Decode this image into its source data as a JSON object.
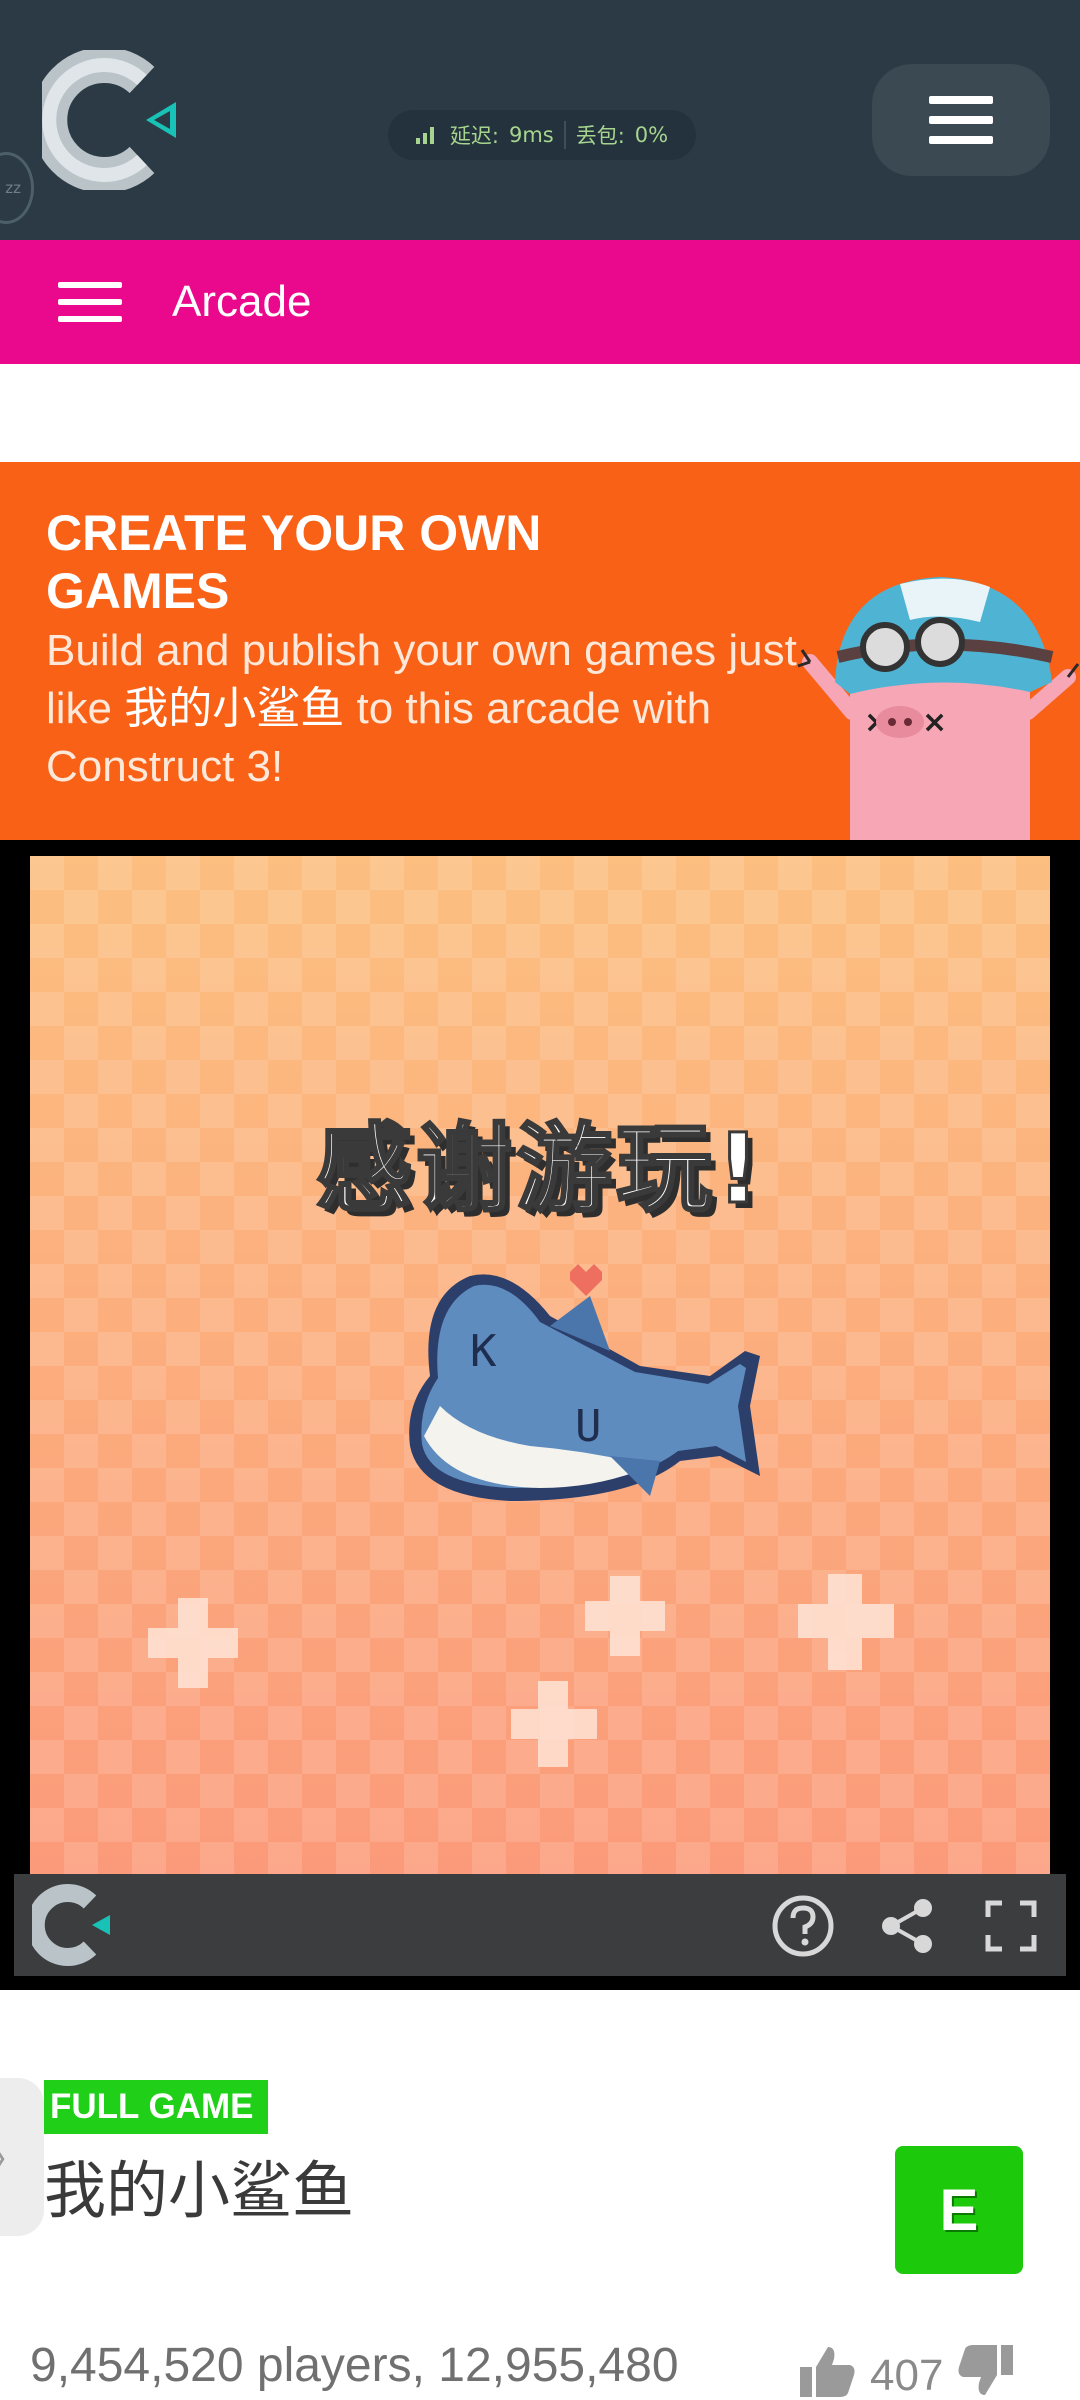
{
  "header": {
    "network": {
      "latency_label": "延迟:",
      "latency_value": "9ms",
      "loss_label": "丢包:",
      "loss_value": "0%"
    },
    "edge_badge": "zz",
    "colors": {
      "background": "#2b3a45",
      "logo_arrow": "#19c2b6"
    }
  },
  "arcade_bar": {
    "title": "Arcade",
    "color": "#ea088c"
  },
  "promo": {
    "heading": "CREATE YOUR OWN GAMES",
    "body_before": "Build and publish your own games just like ",
    "game_name": "我的小鲨鱼",
    "body_after": " to this arcade with Construct 3!",
    "color": "#f86116"
  },
  "game": {
    "canvas_text": "感谢游玩!",
    "shark_labels": {
      "eye": "K",
      "mouth": "U"
    },
    "toolbar_icons": [
      "construct-logo-icon",
      "help-icon",
      "share-icon",
      "fullscreen-icon"
    ]
  },
  "info": {
    "badge": "FULL GAME",
    "title": "我的小鲨鱼",
    "rating": "E",
    "stats": "9,454,520 players, 12,955,480",
    "likes": "407",
    "pull_tab_glyph": "〉"
  }
}
